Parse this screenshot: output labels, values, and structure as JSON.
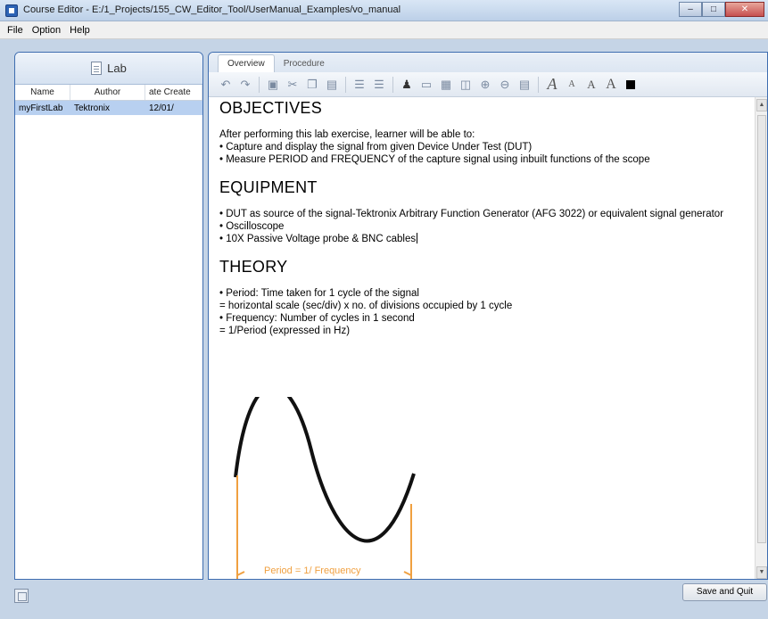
{
  "window": {
    "title": "Course Editor - E:/1_Projects/155_CW_Editor_Tool/UserManual_Examples/vo_manual",
    "controls": {
      "minimize": "–",
      "maximize": "□",
      "close": "✕"
    }
  },
  "menu": [
    "File",
    "Option",
    "Help"
  ],
  "left_panel": {
    "title": "Lab",
    "columns": [
      "Name",
      "Author",
      "ate Create"
    ],
    "rows": [
      {
        "name": "myFirstLab",
        "author": "Tektronix",
        "date": "12/01/"
      }
    ]
  },
  "tabs": [
    "Overview",
    "Procedure"
  ],
  "toolbar": {
    "icons": [
      "undo-icon",
      "redo-icon",
      "save-icon",
      "cut-icon",
      "copy-icon",
      "paste-icon",
      "outdent-icon",
      "indent-icon",
      "users-icon",
      "image-icon",
      "table-icon",
      "link-icon",
      "zoom-in-icon",
      "zoom-out-icon",
      "grid-icon",
      "font-large-icon",
      "font-small-icon",
      "font-medium-icon",
      "font-size-icon",
      "color-icon"
    ],
    "font_glyphs": [
      "A",
      "A",
      "A",
      "A"
    ]
  },
  "document": {
    "objectives_heading": "OBJECTIVES",
    "objectives_lines": [
      "After performing this lab exercise, learner will be able to:",
      "• Capture and display the signal from given Device Under Test (DUT)",
      "• Measure PERIOD and FREQUENCY of the capture signal using inbuilt functions of the scope"
    ],
    "equipment_heading": "EQUIPMENT",
    "equipment_lines": [
      "• DUT as source of the signal-Tektronix Arbitrary Function Generator (AFG 3022) or equivalent signal generator",
      "• Oscilloscope",
      "• 10X Passive Voltage probe & BNC cables"
    ],
    "theory_heading": "THEORY",
    "theory_lines": [
      "• Period: Time taken for 1 cycle of the signal",
      "  = horizontal scale (sec/div) x no. of divisions occupied by 1 cycle",
      "• Frequency: Number of cycles in 1 second",
      "  = 1/Period (expressed in Hz)"
    ],
    "figure_label": "Period = 1/ Frequency"
  },
  "footer": {
    "save_quit": "Save and Quit"
  },
  "colors": {
    "accent": "#3e6db0",
    "selection": "#b8d0f0",
    "period_marker": "#f0a040"
  }
}
